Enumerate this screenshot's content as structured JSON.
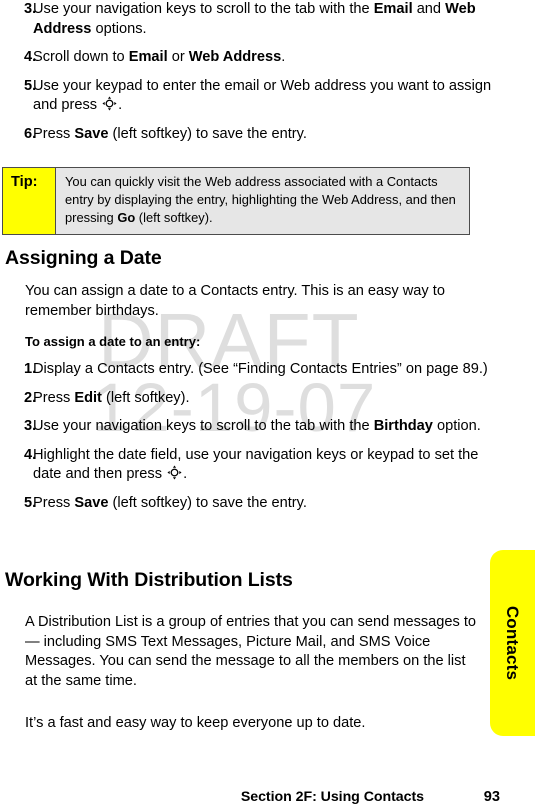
{
  "watermark": {
    "line1": "DRAFT",
    "line2": "12-19-07",
    "color": "#dedede"
  },
  "colors": {
    "tip_label_bg": "#ffff00",
    "tip_body_bg": "#e6e6e6",
    "tip_border": "#4c4c4c",
    "side_tab_bg": "#ffff00",
    "text": "#000000"
  },
  "top_steps": [
    {
      "number": "3.",
      "parts": [
        {
          "text": "Use your navigation keys to scroll to the tab with the "
        },
        {
          "text": "Email",
          "bold": true
        },
        {
          "text": " and "
        },
        {
          "text": "Web Address",
          "bold": true
        },
        {
          "text": " options."
        }
      ]
    },
    {
      "number": "4.",
      "parts": [
        {
          "text": "Scroll down to "
        },
        {
          "text": "Email",
          "bold": true
        },
        {
          "text": " or "
        },
        {
          "text": "Web Address",
          "bold": true
        },
        {
          "text": "."
        }
      ]
    },
    {
      "number": "5.",
      "parts": [
        {
          "text": "Use your keypad to enter the email or Web address you want to assign and press "
        },
        {
          "icon": "navigation-key-icon"
        },
        {
          "text": "."
        }
      ]
    },
    {
      "number": "6.",
      "parts": [
        {
          "text": "Press "
        },
        {
          "text": "Save",
          "bold": true
        },
        {
          "text": " (left softkey) to save the entry."
        }
      ]
    }
  ],
  "tip": {
    "label": "Tip:",
    "parts": [
      {
        "text": "You can quickly visit the Web address associated with a Contacts entry by displaying the entry, highlighting the Web Address, and then pressing "
      },
      {
        "text": "Go",
        "bold": true
      },
      {
        "text": " (left softkey)."
      }
    ]
  },
  "section_date": {
    "heading": "Assigning a Date",
    "intro": "You can assign a date to a Contacts entry. This is an easy way to remember birthdays.",
    "subheading": "To assign a date to an entry:",
    "steps": [
      {
        "number": "1.",
        "parts": [
          {
            "text": "Display a Contacts entry. (See “Finding Contacts Entries” on page 89.)"
          }
        ]
      },
      {
        "number": "2.",
        "parts": [
          {
            "text": "Press "
          },
          {
            "text": "Edit",
            "bold": true
          },
          {
            "text": " (left softkey)."
          }
        ]
      },
      {
        "number": "3.",
        "parts": [
          {
            "text": "Use your navigation keys to scroll to the tab with the "
          },
          {
            "text": "Birthday",
            "bold": true
          },
          {
            "text": " option."
          }
        ]
      },
      {
        "number": "4.",
        "parts": [
          {
            "text": "Highlight the date field, use your navigation keys or keypad to set the date and then press "
          },
          {
            "icon": "navigation-key-icon"
          },
          {
            "text": "."
          }
        ]
      },
      {
        "number": "5.",
        "parts": [
          {
            "text": "Press "
          },
          {
            "text": "Save",
            "bold": true
          },
          {
            "text": " (left softkey) to save the entry."
          }
        ]
      }
    ]
  },
  "section_lists": {
    "heading": "Working With Distribution Lists",
    "paragraph1": "A Distribution List is a group of entries that you can send messages to — including SMS Text Messages, Picture Mail, and SMS Voice Messages. You can send the message to all the members on the list at the same time.",
    "paragraph2": "It’s a fast and easy way to keep everyone up to date."
  },
  "side_tab": {
    "label": "Contacts"
  },
  "footer": {
    "section": "Section 2F: Using Contacts",
    "page_number": "93"
  }
}
